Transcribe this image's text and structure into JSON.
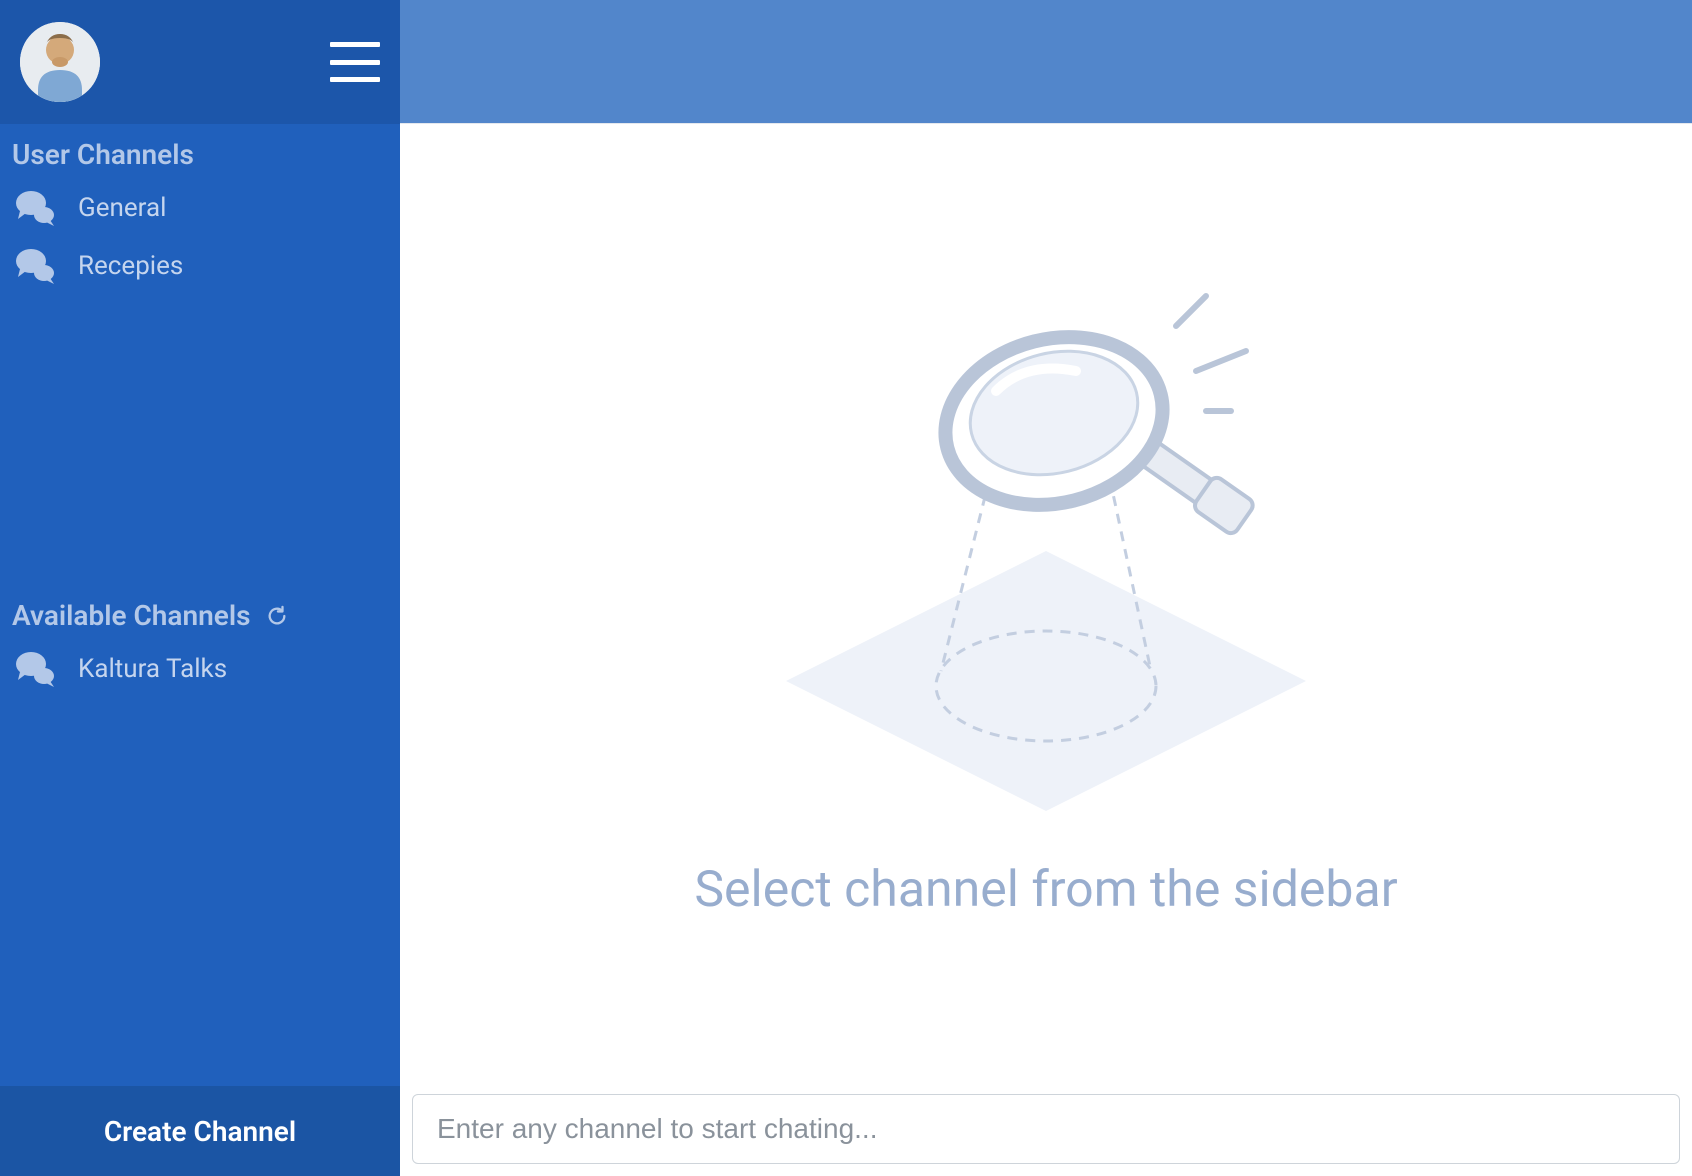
{
  "sidebar": {
    "sections": {
      "user_channels": {
        "heading": "User Channels",
        "items": [
          {
            "label": "General"
          },
          {
            "label": "Recepies"
          }
        ]
      },
      "available_channels": {
        "heading": "Available Channels",
        "items": [
          {
            "label": "Kaltura Talks"
          }
        ]
      }
    },
    "create_button": "Create Channel"
  },
  "main": {
    "empty_state_text": "Select channel from the sidebar",
    "input_placeholder": "Enter any channel to start chating..."
  }
}
